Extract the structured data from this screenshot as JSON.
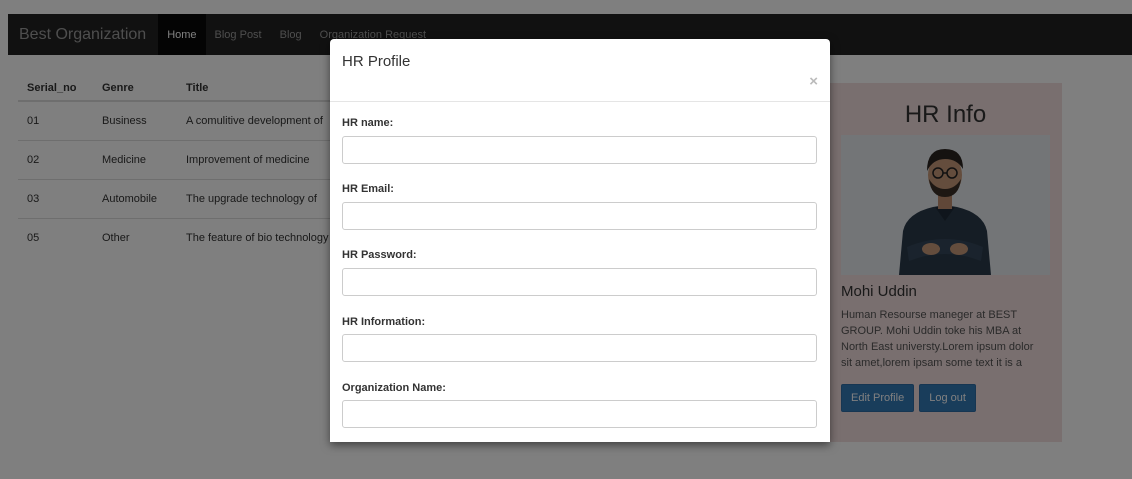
{
  "navbar": {
    "brand": "Best Organization",
    "links": [
      "Home",
      "Blog Post",
      "Blog",
      "Organization Request"
    ]
  },
  "table": {
    "headers": [
      "Serial_no",
      "Genre",
      "Title"
    ],
    "rows": [
      [
        "01",
        "Business",
        "A comulitive development of"
      ],
      [
        "02",
        "Medicine",
        "Improvement of medicine"
      ],
      [
        "03",
        "Automobile",
        "The upgrade technology of"
      ],
      [
        "05",
        "Other",
        "The feature of bio technology"
      ]
    ]
  },
  "card": {
    "title": "HR Info",
    "name": "Mohi Uddin",
    "description": "Human Resourse maneger at BEST GROUP. Mohi Uddin toke his MBA at North East universty.Lorem ipsum dolor sit amet,lorem ipsam some text it is a",
    "edit_label": "Edit Profile",
    "logout_label": "Log out"
  },
  "modal": {
    "title": "HR Profile",
    "close_glyph": "×",
    "fields": [
      {
        "label": "HR name:",
        "value": ""
      },
      {
        "label": "HR Email:",
        "value": ""
      },
      {
        "label": "HR Password:",
        "value": ""
      },
      {
        "label": "HR Information:",
        "value": ""
      },
      {
        "label": "Organization Name:",
        "value": ""
      }
    ]
  },
  "colors": {
    "navbar": "#222222",
    "card_bg": "#f2dede",
    "primary": "#337ab7"
  }
}
